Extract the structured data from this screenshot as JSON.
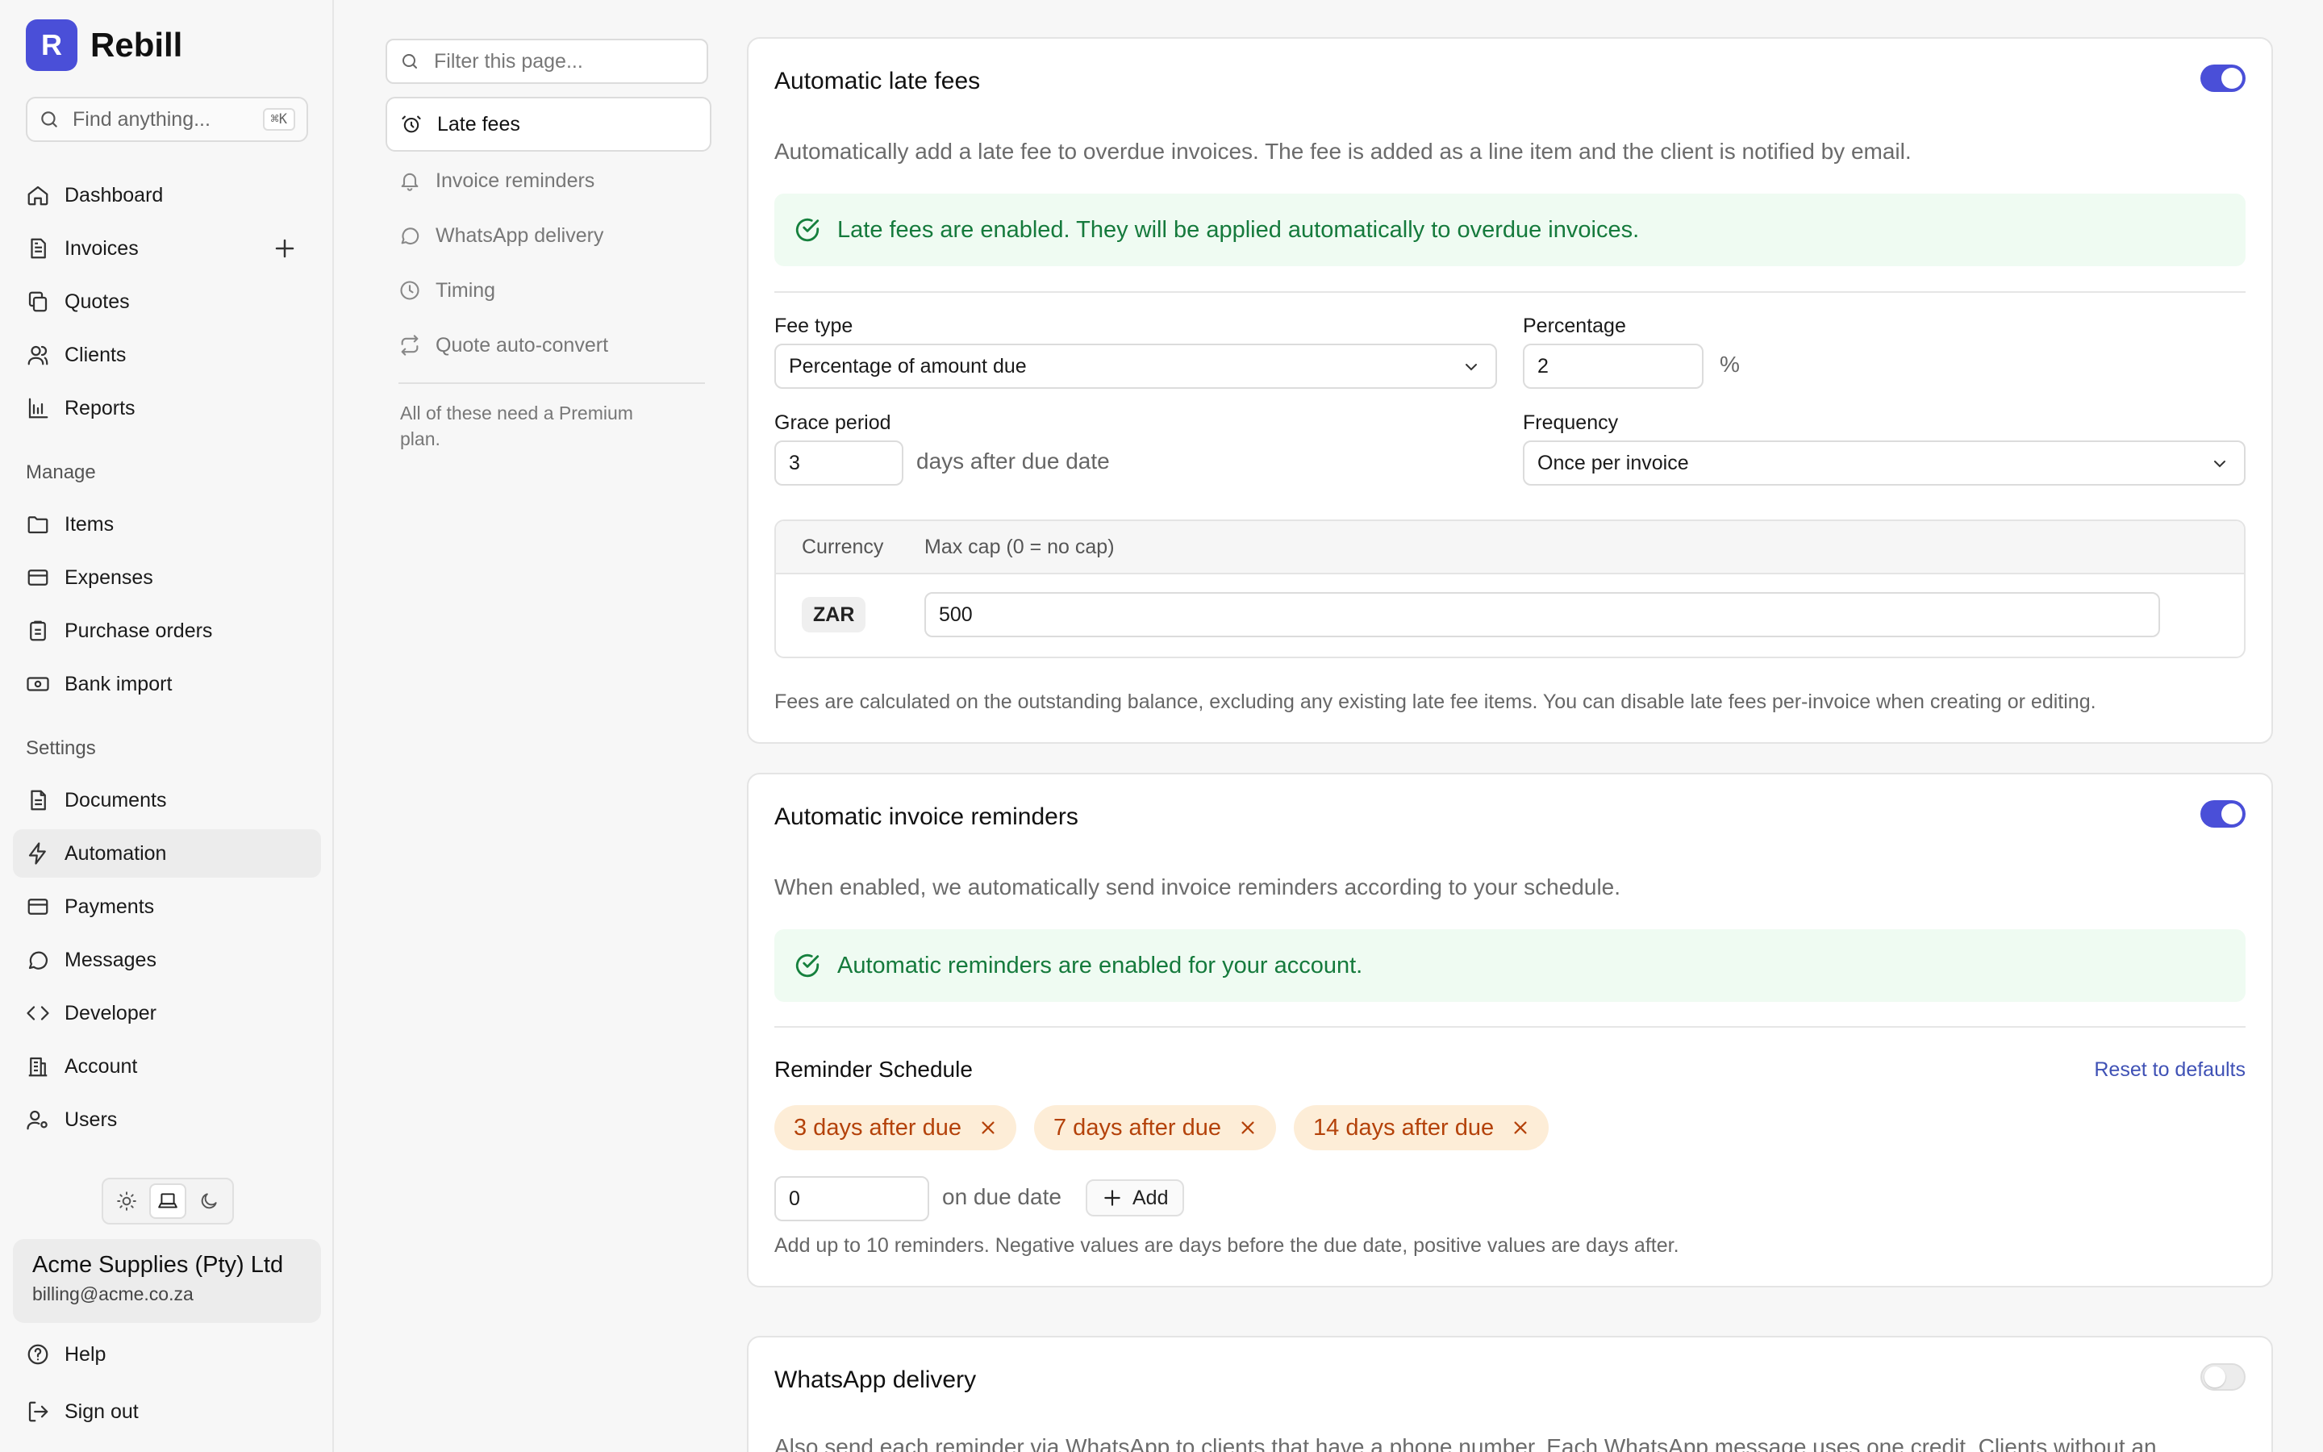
{
  "app": {
    "logo_letter": "R",
    "name": "Rebill",
    "accent": "#4a4fd8"
  },
  "search": {
    "placeholder": "Find anything...",
    "shortcut": "⌘K"
  },
  "sidebar": {
    "main": [
      {
        "label": "Dashboard",
        "icon": "home-icon"
      },
      {
        "label": "Invoices",
        "icon": "invoice-icon"
      },
      {
        "label": "Quotes",
        "icon": "copy-icon"
      },
      {
        "label": "Clients",
        "icon": "users-icon"
      },
      {
        "label": "Reports",
        "icon": "chart-icon"
      }
    ],
    "manage_heading": "Manage",
    "manage": [
      {
        "label": "Items",
        "icon": "folder-icon"
      },
      {
        "label": "Expenses",
        "icon": "card-icon"
      },
      {
        "label": "Purchase orders",
        "icon": "clipboard-icon"
      },
      {
        "label": "Bank import",
        "icon": "banknote-icon"
      }
    ],
    "settings_heading": "Settings",
    "settings": [
      {
        "label": "Documents",
        "icon": "document-icon"
      },
      {
        "label": "Automation",
        "icon": "zap-icon",
        "active": true
      },
      {
        "label": "Payments",
        "icon": "card-icon"
      },
      {
        "label": "Messages",
        "icon": "message-icon"
      },
      {
        "label": "Developer",
        "icon": "code-icon"
      },
      {
        "label": "Account",
        "icon": "building-icon"
      },
      {
        "label": "Users",
        "icon": "user-cog-icon"
      }
    ],
    "account": {
      "name": "Acme Supplies (Pty) Ltd",
      "email": "billing@acme.co.za"
    },
    "help": "Help",
    "sign_out": "Sign out"
  },
  "subnav": {
    "filter_placeholder": "Filter this page...",
    "items": [
      {
        "label": "Late fees",
        "icon": "alarm-icon",
        "active": true
      },
      {
        "label": "Invoice reminders",
        "icon": "bell-icon"
      },
      {
        "label": "WhatsApp delivery",
        "icon": "message-icon"
      },
      {
        "label": "Timing",
        "icon": "clock-icon"
      },
      {
        "label": "Quote auto-convert",
        "icon": "repeat-icon"
      }
    ],
    "note": "All of these need a Premium plan."
  },
  "late_fees": {
    "title": "Automatic late fees",
    "enabled": true,
    "description": "Automatically add a late fee to overdue invoices. The fee is added as a line item and the client is notified by email.",
    "alert": "Late fees are enabled. They will be applied automatically to overdue invoices.",
    "fee_type_label": "Fee type",
    "fee_type_value": "Percentage of amount due",
    "percentage_label": "Percentage",
    "percentage_value": "2",
    "percentage_suffix": "%",
    "grace_label": "Grace period",
    "grace_value": "3",
    "grace_suffix": "days after due date",
    "frequency_label": "Frequency",
    "frequency_value": "Once per invoice",
    "cap_table": {
      "col_currency": "Currency",
      "col_cap": "Max cap (0 = no cap)",
      "rows": [
        {
          "currency": "ZAR",
          "cap": "500"
        }
      ]
    },
    "footnote": "Fees are calculated on the outstanding balance, excluding any existing late fee items. You can disable late fees per-invoice when creating or editing."
  },
  "reminders": {
    "title": "Automatic invoice reminders",
    "enabled": true,
    "description": "When enabled, we automatically send invoice reminders according to your schedule.",
    "alert": "Automatic reminders are enabled for your account.",
    "schedule_title": "Reminder Schedule",
    "reset_label": "Reset to defaults",
    "chips": [
      "3 days after due",
      "7 days after due",
      "14 days after due"
    ],
    "new_days_value": "0",
    "new_days_suffix": "on due date",
    "add_label": "Add",
    "help": "Add up to 10 reminders. Negative values are days before the due date, positive values are days after."
  },
  "whatsapp": {
    "title": "WhatsApp delivery",
    "enabled": false,
    "description": "Also send each reminder via WhatsApp to clients that have a phone number. Each WhatsApp message uses one credit. Clients without an"
  }
}
